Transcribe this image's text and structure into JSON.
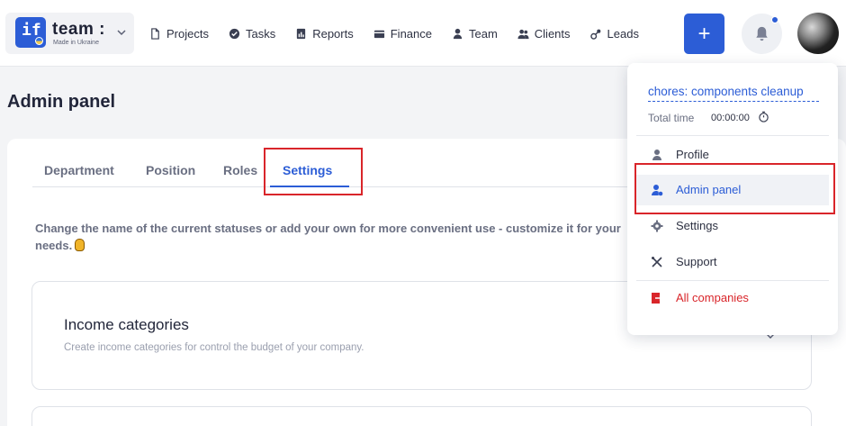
{
  "brand": {
    "name": "team :",
    "tagline": "Made in Ukraine",
    "logo_text": "if"
  },
  "nav": [
    {
      "label": "Projects",
      "icon": "document-icon"
    },
    {
      "label": "Tasks",
      "icon": "check-circle-icon"
    },
    {
      "label": "Reports",
      "icon": "report-icon"
    },
    {
      "label": "Finance",
      "icon": "wallet-icon"
    },
    {
      "label": "Team",
      "icon": "person-icon"
    },
    {
      "label": "Clients",
      "icon": "people-icon"
    },
    {
      "label": "Leads",
      "icon": "leads-icon"
    }
  ],
  "actions": {
    "add_label": "+"
  },
  "page": {
    "title": "Admin panel"
  },
  "tabs": [
    {
      "label": "Department"
    },
    {
      "label": "Position"
    },
    {
      "label": "Roles"
    },
    {
      "label": "Settings",
      "active": true
    }
  ],
  "description": "Change the name of the current statuses or add your own for more convenient use - customize it for your needs.",
  "sections": [
    {
      "title": "Income categories",
      "subtitle": "Create income categories for control the budget of your company."
    }
  ],
  "dropdown": {
    "task": "chores: components cleanup",
    "total_time_label": "Total time",
    "total_time_value": "00:00:00",
    "items": [
      {
        "label": "Profile",
        "icon": "person-icon"
      },
      {
        "label": "Admin panel",
        "icon": "admin-user-icon",
        "active": true
      },
      {
        "label": "Settings",
        "icon": "gear-icon"
      },
      {
        "label": "Support",
        "icon": "tools-icon"
      },
      {
        "label": "All companies",
        "icon": "exit-icon",
        "danger": true
      }
    ]
  },
  "colors": {
    "accent": "#2c5dd6",
    "danger": "#d9252a",
    "highlight": "#d9252a"
  }
}
